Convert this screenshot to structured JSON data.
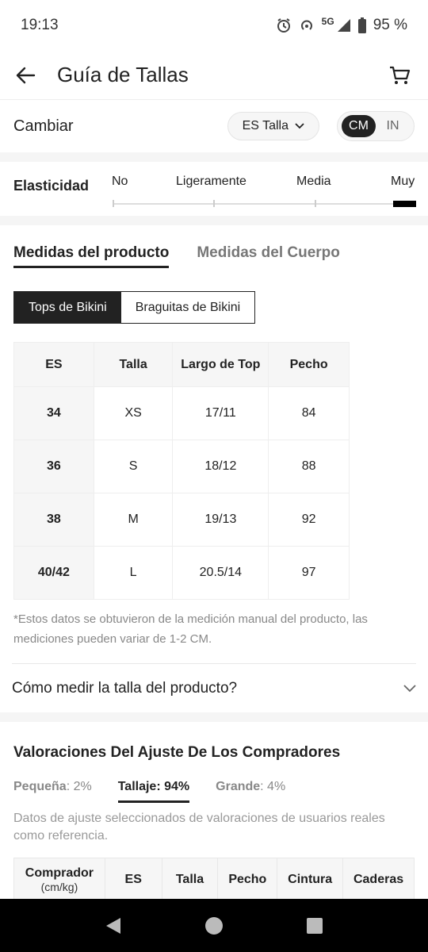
{
  "status_bar": {
    "time": "19:13",
    "network": "5G",
    "battery": "95 %"
  },
  "header": {
    "title": "Guía de Tallas",
    "back_icon": "arrow-left-icon",
    "cart_icon": "cart-icon"
  },
  "change": {
    "label": "Cambiar",
    "size_system": "ES Talla",
    "units": [
      "CM",
      "IN"
    ],
    "active_unit": "CM"
  },
  "elasticity": {
    "label": "Elasticidad",
    "options": [
      "No",
      "Ligeramente",
      "Media",
      "Muy"
    ],
    "selected": "Muy"
  },
  "tabs": {
    "items": [
      "Medidas del producto",
      "Medidas del Cuerpo"
    ],
    "active": "Medidas del producto"
  },
  "segments": {
    "items": [
      "Tops de Bikini",
      "Braguitas de Bikini"
    ],
    "active": "Tops de Bikini"
  },
  "size_table": {
    "headers": [
      "ES",
      "Talla",
      "Largo de Top",
      "Pecho"
    ],
    "rows": [
      [
        "34",
        "XS",
        "17/11",
        "84"
      ],
      [
        "36",
        "S",
        "18/12",
        "88"
      ],
      [
        "38",
        "M",
        "19/13",
        "92"
      ],
      [
        "40/42",
        "L",
        "20.5/14",
        "97"
      ]
    ]
  },
  "note": "*Estos datos se obtuvieron de la medición manual del producto, las mediciones pueden variar de 1-2 CM.",
  "measure": {
    "label": "Cómo medir la talla del producto?"
  },
  "fit": {
    "title": "Valoraciones Del Ajuste De Los Compradores",
    "tabs": [
      {
        "key": "Pequeña",
        "value": "2%"
      },
      {
        "key": "Tallaje:",
        "value": "94%"
      },
      {
        "key": "Grande",
        "value": "4%"
      }
    ],
    "note": "Datos de ajuste seleccionados de valoraciones de usuarios reales como referencia."
  },
  "buyer_table": {
    "headers": [
      "Comprador",
      "ES",
      "Talla",
      "Pecho",
      "Cintura",
      "Caderas"
    ],
    "buyer_sub": "(cm/kg)"
  },
  "colors": {
    "accent": "#222222",
    "muted": "#888888",
    "band": "#f5f5f5"
  }
}
